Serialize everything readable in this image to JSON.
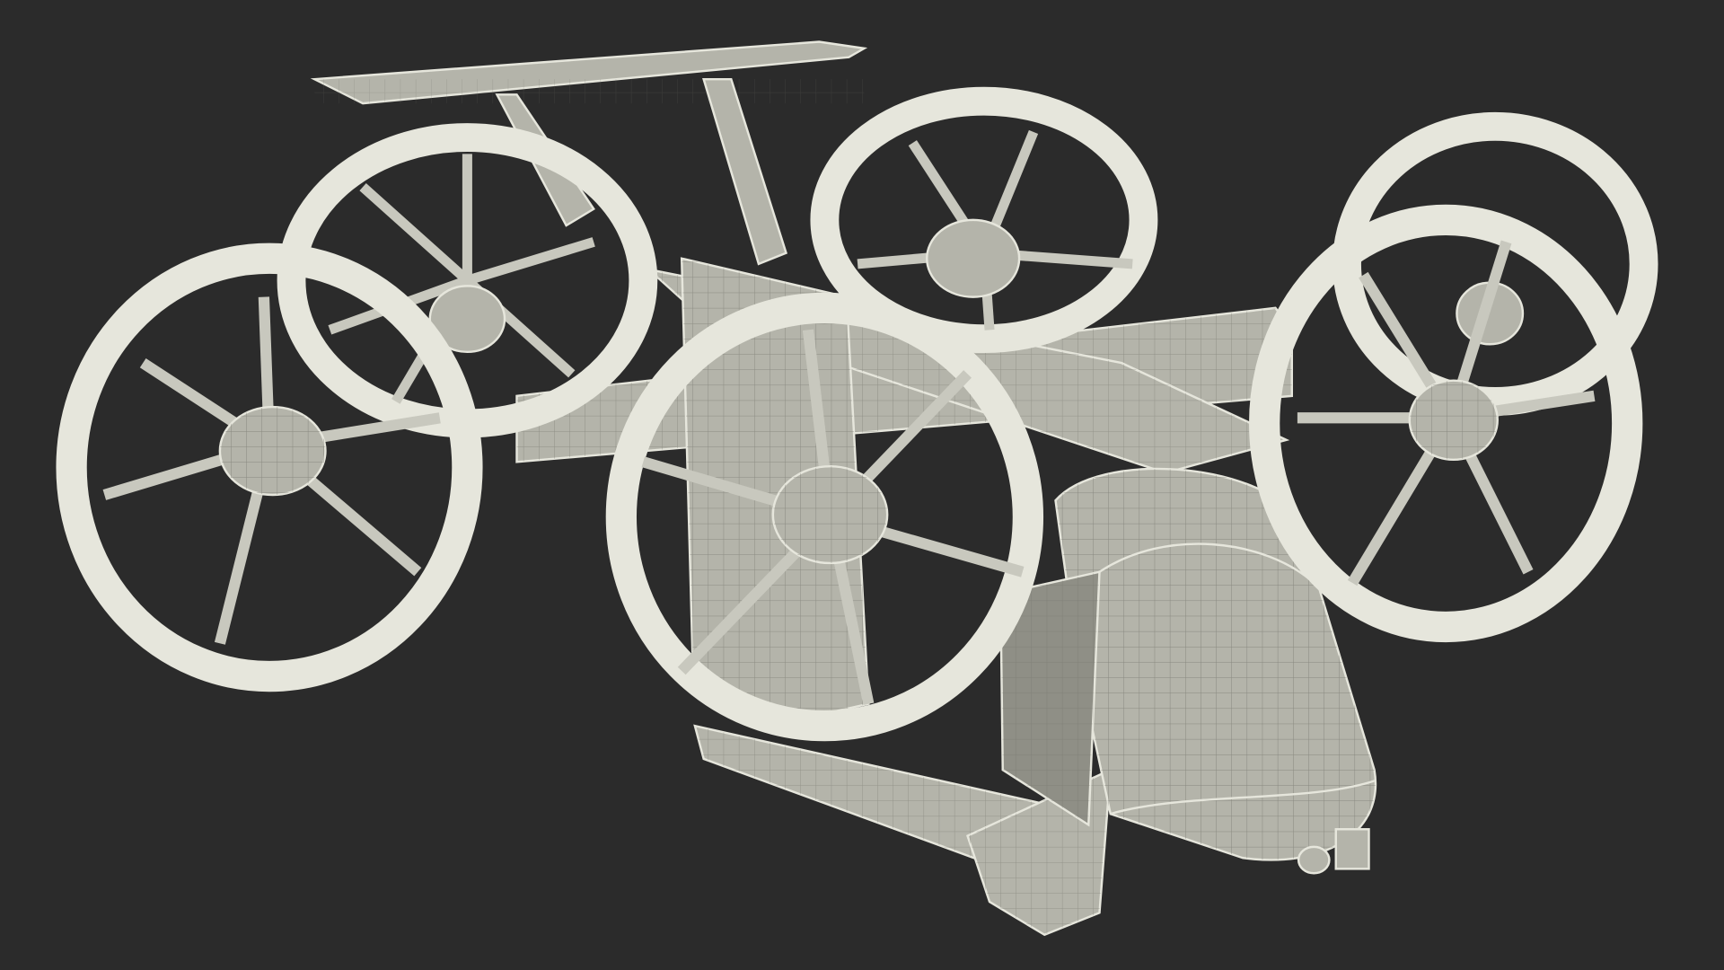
{
  "scene": {
    "subject": "wireframe-aircraft",
    "background_color": "#2b2b2b",
    "wire_color": "#e6e6dc",
    "surface_color": "#b4b4aa",
    "rotor_count": 6
  }
}
